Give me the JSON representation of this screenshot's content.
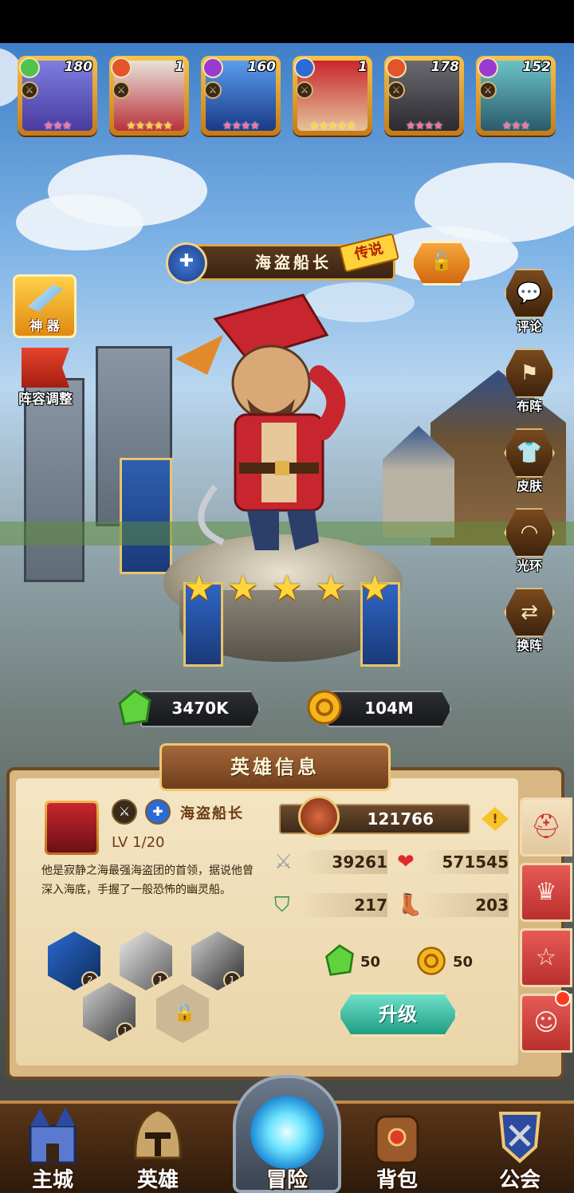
{
  "top_heroes": [
    {
      "count": "180",
      "element_color": "#4fc24f",
      "stars": 3,
      "star_color": "pink"
    },
    {
      "count": "1",
      "element_color": "#e3542a",
      "stars": 5,
      "star_color": "gold"
    },
    {
      "count": "160",
      "element_color": "#9a3ad0",
      "stars": 4,
      "star_color": "pink"
    },
    {
      "count": "1",
      "element_color": "#2c6ad6",
      "stars": 5,
      "star_color": "gold"
    },
    {
      "count": "178",
      "element_color": "#e3542a",
      "stars": 4,
      "star_color": "pink"
    },
    {
      "count": "152",
      "element_color": "#9a3ad0",
      "stars": 3,
      "star_color": "pink"
    }
  ],
  "hero": {
    "name": "海盗船长",
    "rarity_tag": "传说",
    "stars": 5,
    "level": "LV 1/20",
    "description": "他是寂静之海最强海盗团的首领，据说他曾深入海底，手握了一般恐怖的幽灵船。"
  },
  "left_buttons": {
    "artifact_label": "神 器",
    "lineup_label": "阵容调整"
  },
  "side_buttons": [
    "评论",
    "布阵",
    "皮肤",
    "光环",
    "换阵"
  ],
  "currency": {
    "gems": "3470K",
    "gold": "104M"
  },
  "panel": {
    "title": "英雄信息",
    "power": "121766",
    "attack": "39261",
    "hp": "571545",
    "defense": "217",
    "speed": "203",
    "cost_gems": "50",
    "cost_gold": "50",
    "upgrade_label": "升级"
  },
  "skills": [
    {
      "level": "2"
    },
    {
      "level": "1"
    },
    {
      "level": "1"
    },
    {
      "level": "1"
    }
  ],
  "bottom_nav": {
    "city": "主城",
    "heroes": "英雄",
    "adventure": "冒险",
    "bag": "背包",
    "guild": "公会"
  },
  "colors": {
    "accent_gold": "#f0c772",
    "tab_red": "#d8423e",
    "upgrade_teal": "#2bb79a"
  }
}
